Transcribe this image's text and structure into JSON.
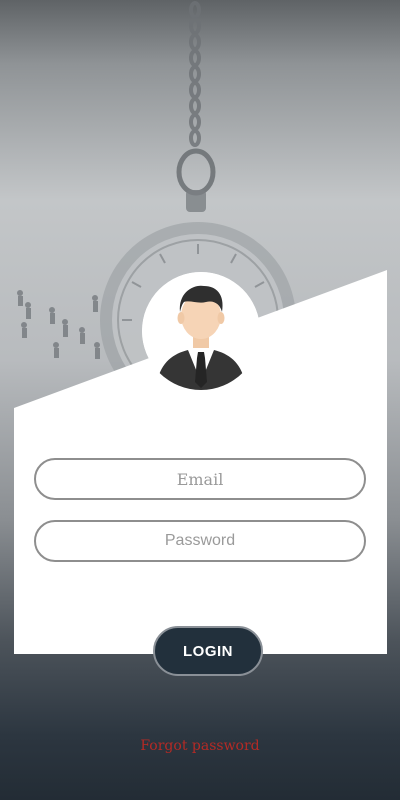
{
  "login_form": {
    "email_placeholder": "Email",
    "password_placeholder": "Password",
    "login_label": "LOGIN",
    "forgot_password_label": "Forgot password"
  },
  "colors": {
    "button_background": "#22303c",
    "forgot_link": "#b52a25",
    "card_background": "#ffffff"
  },
  "icons": {
    "avatar": "businessman-avatar-icon"
  }
}
